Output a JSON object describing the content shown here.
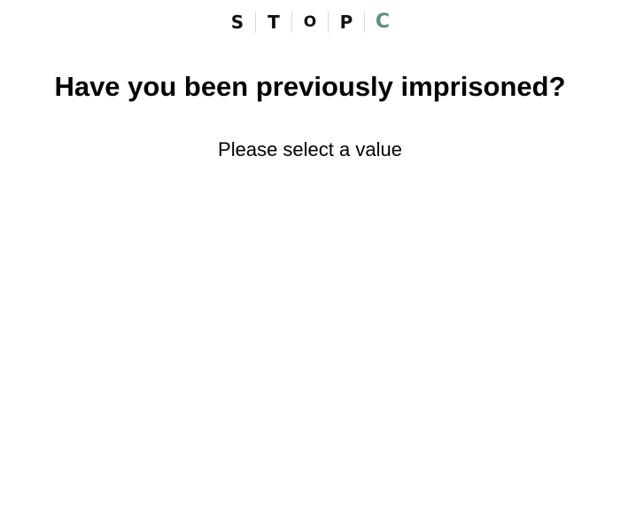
{
  "logo": {
    "letters": [
      "S",
      "T",
      "O",
      "P",
      "C"
    ],
    "accent_color": "#5f8f82",
    "text_color": "#111111",
    "divider_color": "#d8d8d8"
  },
  "question": {
    "title": "Have you been previously imprisoned?",
    "prompt": "Please select a value"
  }
}
